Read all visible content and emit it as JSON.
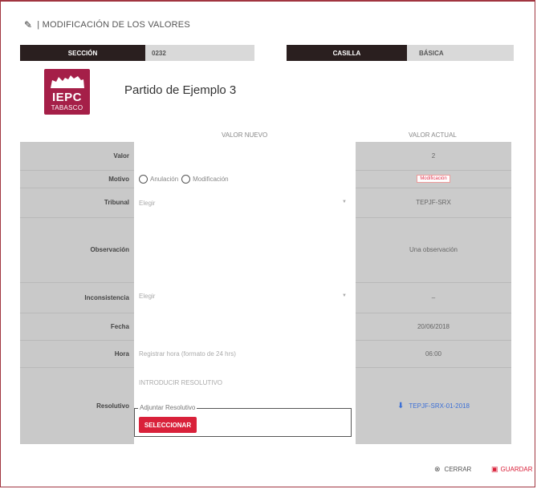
{
  "header": {
    "title": "| MODIFICACIÓN DE LOS VALORES"
  },
  "seccion": {
    "label": "SECCIÓN",
    "value": "0232"
  },
  "casilla": {
    "label": "CASILLA",
    "value": "BÁSICA"
  },
  "logo": {
    "text": "IEPC",
    "subtext": "TABASCO"
  },
  "party_name": "Partido de Ejemplo 3",
  "columns": {
    "new": "VALOR NUEVO",
    "current": "VALOR ACTUAL"
  },
  "rows": {
    "valor": {
      "label": "Valor",
      "current": "2"
    },
    "motivo": {
      "label": "Motivo",
      "option1": "Anulación",
      "option2": "Modificación",
      "current": "Modificación"
    },
    "tribunal": {
      "label": "Tribunal",
      "placeholder": "Elegir",
      "current": "TEPJF-SRX"
    },
    "observacion": {
      "label": "Observación",
      "current": "Una observación"
    },
    "inconsistencia": {
      "label": "Inconsistencia",
      "placeholder": "Elegir",
      "current": "–"
    },
    "fecha": {
      "label": "Fecha",
      "current": "20/06/2018"
    },
    "hora": {
      "label": "Hora",
      "placeholder": "Registrar hora (formato de 24 hrs)",
      "current": "06:00"
    },
    "resolutivo": {
      "label": "Resolutivo",
      "intro": "INTRODUCIR RESOLUTIVO",
      "legend": "Adjuntar Resolutivo",
      "button": "SELECCIONAR",
      "current": "TEPJF-SRX-01-2018"
    }
  },
  "footer": {
    "close": "CERRAR",
    "save": "GUARDAR"
  },
  "colors": {
    "accent": "#d9213a",
    "brand": "#a51f48",
    "dark": "#2a1f1f"
  }
}
